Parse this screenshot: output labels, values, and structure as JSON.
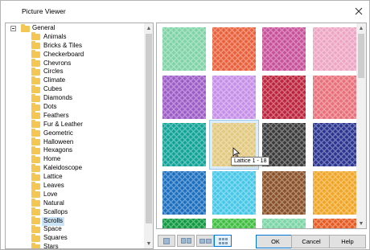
{
  "window": {
    "title": "Picture Viewer"
  },
  "tree": {
    "root": "General",
    "selected_index": 21,
    "items": [
      "Animals",
      "Bricks & Tiles",
      "Checkerboard",
      "Chevrons",
      "Circles",
      "Climate",
      "Cubes",
      "Diamonds",
      "Dots",
      "Feathers",
      "Fur & Leather",
      "Geometric",
      "Halloween",
      "Hexagons",
      "Home",
      "Kaleidoscope",
      "Lattice",
      "Leaves",
      "Love",
      "Natural",
      "Scallops",
      "Scrolls",
      "Space",
      "Squares",
      "Stars"
    ]
  },
  "pictures": {
    "selected_tooltip": "Lattice 1 - 18",
    "rows": [
      [
        "#7fd4a6",
        "#e9603a",
        "#c8519a",
        "#eea5c3"
      ],
      [
        "#9e5cc8",
        "#c68ee8",
        "#bd233b",
        "#e9707a"
      ],
      [
        "#0fa497",
        "#e3c97e",
        "#3a3a3a",
        "#2a3592"
      ],
      [
        "#1b6fc0",
        "#45c8e8",
        "#8a5128",
        "#f1a524"
      ],
      [
        "#0e9a3f",
        "#3fbf3f",
        "#7ad6a5",
        "#e65a22"
      ]
    ]
  },
  "view_buttons": [
    "single-view",
    "two-column-view",
    "wide-view",
    "grid-view"
  ],
  "buttons": {
    "ok": "OK",
    "cancel": "Cancel",
    "help": "Help"
  }
}
